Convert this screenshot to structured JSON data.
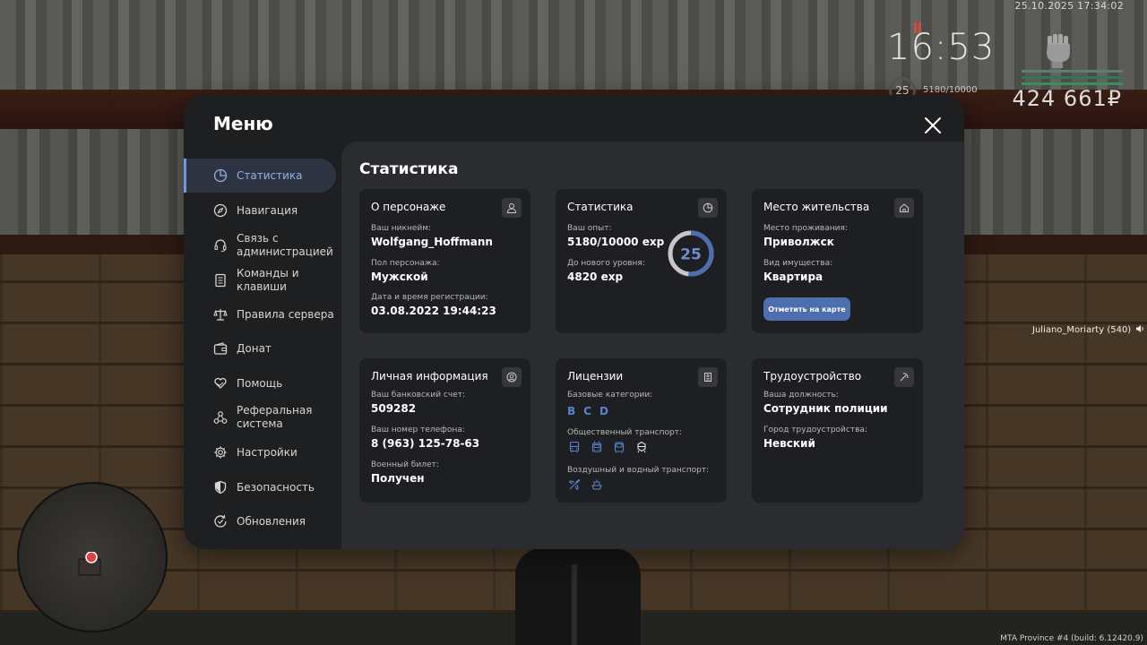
{
  "hud": {
    "datetime": "25.10.2025 17:34:02",
    "time": "16:53",
    "level": "25",
    "exp": "5180/10000",
    "money": "424 661₽",
    "nametag": "Juliano_Moriarty (540)",
    "build": "MTA Province #4 (build: 6.12420.9)",
    "bar_colors": [
      "#5d7d76",
      "#2f7a4c",
      "#3a8f5e"
    ]
  },
  "menu": {
    "title": "Меню",
    "sidebar": [
      {
        "label": "Статистика",
        "icon": "pie-chart-icon",
        "active": true
      },
      {
        "label": "Навигация",
        "icon": "compass-icon"
      },
      {
        "label": "Связь с администрацией",
        "icon": "headset-icon"
      },
      {
        "label": "Команды и клавиши",
        "icon": "document-icon"
      },
      {
        "label": "Правила сервера",
        "icon": "scales-icon"
      },
      {
        "label": "Донат",
        "icon": "wallet-icon"
      },
      {
        "label": "Помощь",
        "icon": "heart-hands-icon"
      },
      {
        "label": "Реферальная система",
        "icon": "network-icon"
      },
      {
        "label": "Настройки",
        "icon": "gear-icon"
      },
      {
        "label": "Безопасность",
        "icon": "shield-icon"
      },
      {
        "label": "Обновления",
        "icon": "refresh-check-icon"
      }
    ],
    "content_title": "Статистика",
    "character": {
      "title": "О персонаже",
      "nickname_label": "Ваш никнейм:",
      "nickname": "Wolfgang_Hoffmann",
      "gender_label": "Пол персонажа:",
      "gender": "Мужской",
      "reg_label": "Дата и время регистрации:",
      "reg": "03.08.2022 19:44:23"
    },
    "stats": {
      "title": "Статистика",
      "exp_label": "Ваш опыт:",
      "exp": "5180/10000 exp",
      "next_label": "До нового уровня:",
      "next": "4820 exp",
      "level": "25",
      "progress": 0.518,
      "accent": "#4d6fae"
    },
    "residence": {
      "title": "Место жительства",
      "place_label": "Место проживания:",
      "place": "Приволжск",
      "type_label": "Вид имущества:",
      "type": "Квартира",
      "button": "Отметить на карте"
    },
    "personal": {
      "title": "Личная информация",
      "bank_label": "Ваш банковский счет:",
      "bank": "509282",
      "phone_label": "Ваш номер телефона:",
      "phone": "8 (963) 125-78-63",
      "military_label": "Военный билет:",
      "military": "Получен"
    },
    "licenses": {
      "title": "Лицензии",
      "base_label": "Базовые категории:",
      "categories": [
        "B",
        "C",
        "D"
      ],
      "public_label": "Общественный транспорт:",
      "air_label": "Воздушный и водный транспорт:"
    },
    "employment": {
      "title": "Трудоустройство",
      "position_label": "Ваша должность:",
      "position": "Сотрудник полиции",
      "city_label": "Город трудоустройства:",
      "city": "Невский"
    }
  }
}
